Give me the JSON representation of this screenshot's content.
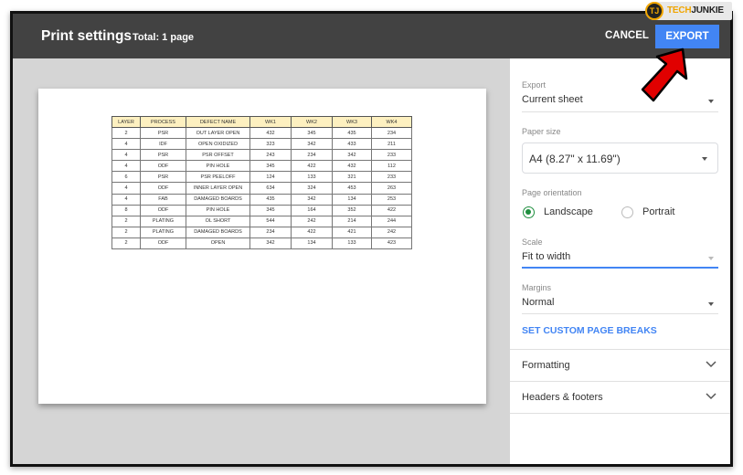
{
  "header": {
    "title": "Print settings",
    "total": "Total: 1 page",
    "cancel_label": "CANCEL",
    "export_label": "EXPORT"
  },
  "sheet": {
    "columns": [
      "LAYER",
      "PROCESS",
      "DEFECT NAME",
      "WK1",
      "WK2",
      "WK3",
      "WK4"
    ],
    "rows": [
      [
        "2",
        "PSR",
        "OUT LAYER OPEN",
        "432",
        "345",
        "435",
        "234"
      ],
      [
        "4",
        "IDF",
        "OPEN OXIDIZED",
        "323",
        "342",
        "433",
        "211"
      ],
      [
        "4",
        "PSR",
        "PSR OFFSET",
        "243",
        "234",
        "342",
        "233"
      ],
      [
        "4",
        "ODF",
        "PIN HOLE",
        "345",
        "422",
        "432",
        "112"
      ],
      [
        "6",
        "PSR",
        "PSR PEELOFF",
        "124",
        "133",
        "321",
        "233"
      ],
      [
        "4",
        "ODF",
        "INNER LAYER OPEN",
        "634",
        "324",
        "453",
        "263"
      ],
      [
        "4",
        "FAB",
        "DAMAGED BOARDS",
        "435",
        "342",
        "134",
        "253"
      ],
      [
        "8",
        "ODF",
        "PIN HOLE",
        "345",
        "164",
        "352",
        "422"
      ],
      [
        "2",
        "PLATING",
        "OL SHORT",
        "544",
        "242",
        "214",
        "244"
      ],
      [
        "2",
        "PLATING",
        "DAMAGED BOARDS",
        "234",
        "422",
        "421",
        "242"
      ],
      [
        "2",
        "ODF",
        "OPEN",
        "342",
        "134",
        "133",
        "423"
      ]
    ]
  },
  "panel": {
    "export": {
      "label": "Export",
      "value": "Current sheet"
    },
    "paper_size": {
      "label": "Paper size",
      "value": "A4 (8.27\" x 11.69\")"
    },
    "orientation": {
      "label": "Page orientation",
      "options": [
        "Landscape",
        "Portrait"
      ],
      "selected": "Landscape"
    },
    "scale": {
      "label": "Scale",
      "value": "Fit to width"
    },
    "margins": {
      "label": "Margins",
      "value": "Normal"
    },
    "custom_breaks_label": "SET CUSTOM PAGE BREAKS",
    "sections": [
      "Formatting",
      "Headers & footers"
    ]
  },
  "watermark": {
    "logo": "TJ",
    "tech": "TECH",
    "junkie": "JUNKIE"
  },
  "colors": {
    "accent": "#4285f4",
    "header_bg": "#424242",
    "radio_selected": "#1e8e3e",
    "table_header": "#fdf0c0"
  }
}
